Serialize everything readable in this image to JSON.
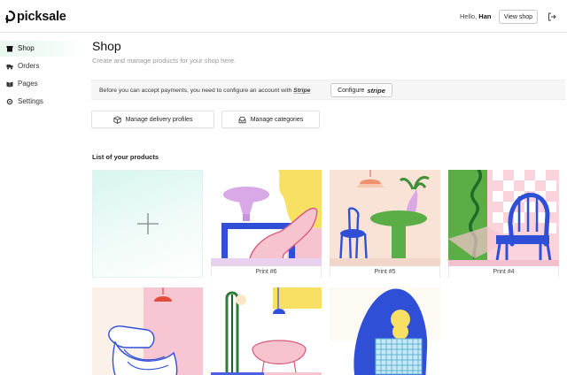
{
  "app": {
    "name": "picksale"
  },
  "header": {
    "greeting": "Hello,",
    "user": "Han",
    "view_shop_label": "View shop",
    "logout_icon": "logout-icon"
  },
  "sidebar": {
    "items": [
      {
        "label": "Shop",
        "icon": "shop-icon",
        "active": true
      },
      {
        "label": "Orders",
        "icon": "truck-icon",
        "active": false
      },
      {
        "label": "Pages",
        "icon": "pages-icon",
        "active": false
      },
      {
        "label": "Settings",
        "icon": "gear-icon",
        "active": false
      }
    ]
  },
  "main": {
    "title": "Shop",
    "subtitle": "Create and manage products for your shop here.",
    "stripe_banner": {
      "text": "Before you can accept payments, you need to configure an account with",
      "brand": "Stripe",
      "button_prefix": "Configure",
      "button_brand": "stripe"
    },
    "actions": [
      {
        "label": "Manage delivery profiles",
        "icon": "box-icon"
      },
      {
        "label": "Manage categories",
        "icon": "tray-icon"
      }
    ],
    "list_title": "List of your products",
    "add_product_icon": "plus-icon",
    "products": [
      {
        "name": "Print #6"
      },
      {
        "name": "Print #5"
      },
      {
        "name": "Print #4"
      },
      {
        "name": ""
      },
      {
        "name": ""
      },
      {
        "name": ""
      }
    ]
  },
  "colors": {
    "accent_mint": "#d7f6ee",
    "sidebar_active": "#eaf8f0",
    "art_yellow": "#f7e063",
    "art_blue": "#2f4fd6",
    "art_pink": "#f6c3cf",
    "art_green": "#5aae45",
    "art_lavender": "#d9a8e6"
  }
}
